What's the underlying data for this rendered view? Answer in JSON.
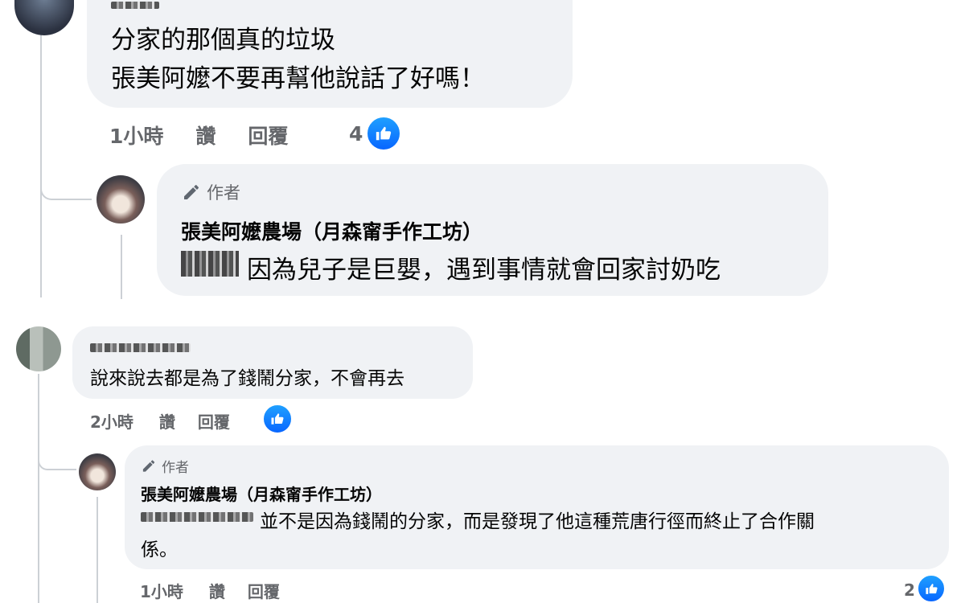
{
  "comments": [
    {
      "body_lines": [
        "分家的那個真的垃圾",
        "張美阿嬤不要再幫他說話了好嗎！"
      ],
      "meta": {
        "time": "1小時",
        "like": "讚",
        "reply": "回覆",
        "reaction_count": "4"
      },
      "reply": {
        "badge": "作者",
        "author": "張美阿嬤農場（月森甯手作工坊）",
        "tag_hidden": "柴柴",
        "text": "因為兒子是巨嬰，遇到事情就會回家討奶吃"
      }
    },
    {
      "body": "說來說去都是為了錢鬧分家，不會再去",
      "meta": {
        "time": "2小時",
        "like": "讚",
        "reply": "回覆"
      },
      "reply": {
        "badge": "作者",
        "author": "張美阿嬤農場（月森甯手作工坊）",
        "text_line1": "並不是因為錢鬧的分家，而是發現了他這種荒唐行徑而終止了合作關",
        "text_line2": "係。",
        "meta": {
          "time": "1小時",
          "like": "讚",
          "reply": "回覆",
          "reaction_count": "2"
        }
      }
    }
  ],
  "colors": {
    "bubble": "#f0f2f5",
    "like_blue": "#0866ff",
    "meta_grey": "#65676b"
  },
  "icons": [
    "like-icon",
    "pencil-icon"
  ]
}
